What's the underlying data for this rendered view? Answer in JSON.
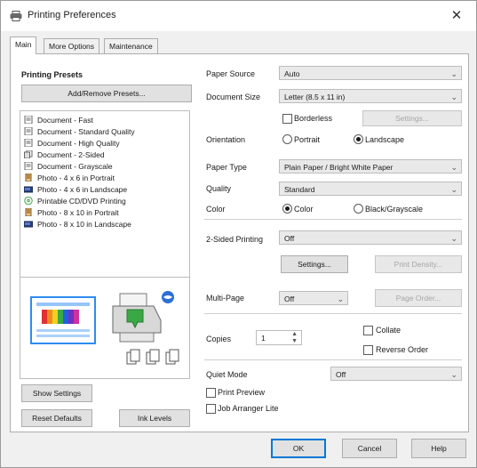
{
  "window": {
    "title": "Printing Preferences",
    "close_glyph": "✕"
  },
  "tabs": [
    {
      "label": "Main"
    },
    {
      "label": "More Options"
    },
    {
      "label": "Maintenance"
    }
  ],
  "presets": {
    "heading": "Printing Presets",
    "add_remove_label": "Add/Remove Presets...",
    "items": [
      {
        "label": "Document - Fast",
        "icon": "document-icon"
      },
      {
        "label": "Document - Standard Quality",
        "icon": "document-icon"
      },
      {
        "label": "Document - High Quality",
        "icon": "document-icon"
      },
      {
        "label": "Document - 2-Sided",
        "icon": "two-sided-icon"
      },
      {
        "label": "Document - Grayscale",
        "icon": "document-icon"
      },
      {
        "label": "Photo - 4 x 6 in Portrait",
        "icon": "photo-portrait-icon"
      },
      {
        "label": "Photo - 4 x 6 in Landscape",
        "icon": "photo-landscape-icon"
      },
      {
        "label": "Printable CD/DVD Printing",
        "icon": "cd-icon"
      },
      {
        "label": "Photo - 8 x 10 in Portrait",
        "icon": "photo-portrait-icon"
      },
      {
        "label": "Photo - 8 x 10 in Landscape",
        "icon": "photo-landscape-icon"
      }
    ]
  },
  "left_buttons": {
    "show_settings": "Show Settings",
    "reset_defaults": "Reset Defaults",
    "ink_levels": "Ink Levels"
  },
  "settings": {
    "paper_source_label": "Paper Source",
    "paper_source_value": "Auto",
    "document_size_label": "Document Size",
    "document_size_value": "Letter (8.5 x 11 in)",
    "borderless_label": "Borderless",
    "borderless_checked": false,
    "borderless_settings_label": "Settings...",
    "orientation_label": "Orientation",
    "portrait_label": "Portrait",
    "landscape_label": "Landscape",
    "orientation_selected": "Landscape",
    "paper_type_label": "Paper Type",
    "paper_type_value": "Plain Paper / Bright White Paper",
    "quality_label": "Quality",
    "quality_value": "Standard",
    "color_label": "Color",
    "color_option_label": "Color",
    "grayscale_option_label": "Black/Grayscale",
    "color_selected": "Color",
    "two_sided_label": "2-Sided Printing",
    "two_sided_value": "Off",
    "two_sided_settings_label": "Settings...",
    "print_density_label": "Print Density...",
    "multi_page_label": "Multi-Page",
    "multi_page_value": "Off",
    "page_order_label": "Page Order...",
    "copies_label": "Copies",
    "copies_value": "1",
    "collate_label": "Collate",
    "reverse_order_label": "Reverse Order",
    "quiet_mode_label": "Quiet Mode",
    "quiet_mode_value": "Off",
    "print_preview_label": "Print Preview",
    "job_arranger_label": "Job Arranger Lite"
  },
  "footer": {
    "ok_label": "OK",
    "cancel_label": "Cancel",
    "help_label": "Help"
  },
  "colors": {
    "accent": "#0078d7",
    "preview_accent": "#2d8cf0",
    "printer_green": "#3aa845"
  }
}
